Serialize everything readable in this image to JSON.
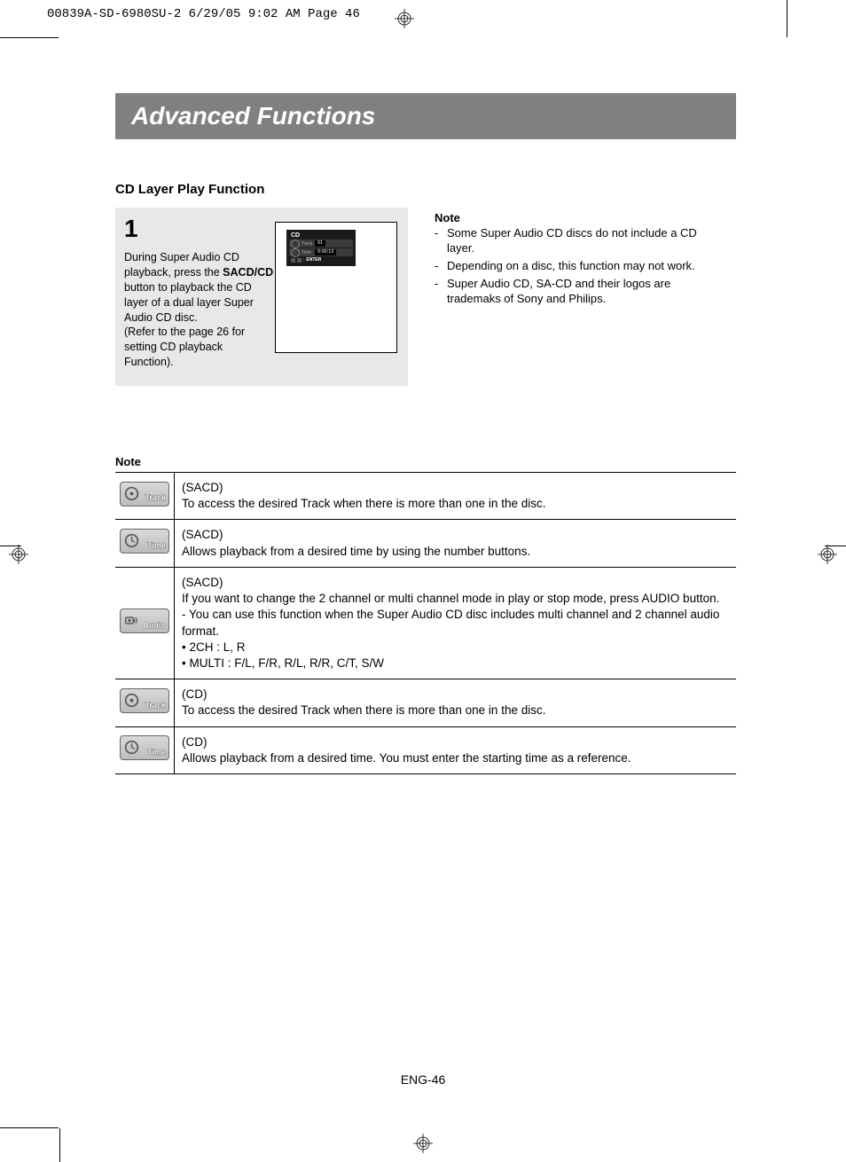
{
  "slug": "00839A-SD-6980SU-2  6/29/05  9:02 AM  Page 46",
  "title": "Advanced Functions",
  "subhead": "CD Layer Play Function",
  "step": {
    "num": "1",
    "text_before_bold": "During Super Audio CD playback, press the ",
    "bold": "SACD/CD",
    "text_after_bold": " button to playback the CD layer of a dual layer Super Audio CD disc.\n(Refer to the page 26 for setting CD playback Function).",
    "osd_title": "CD",
    "osd_track": "01",
    "osd_time": "0:00:13",
    "osd_enter": "ENTER",
    "osd_track_label": "Track",
    "osd_time_label": "Time"
  },
  "side_notes": {
    "heading": "Note",
    "items": [
      "Some Super Audio CD discs do not include a CD layer.",
      "Depending on a disc, this function may not work.",
      "Super Audio CD, SA-CD and their logos are trademaks of Sony and Philips."
    ]
  },
  "table_heading": "Note",
  "rows": [
    {
      "icon": "track",
      "label": "Track",
      "context": "(SACD)",
      "desc": "To access the desired Track when there is more than one in the disc."
    },
    {
      "icon": "time",
      "label": "Time",
      "context": "(SACD)",
      "desc": "Allows playback from a desired time by using the number buttons."
    },
    {
      "icon": "audio",
      "label": "Audio",
      "context": "(SACD)",
      "desc": "If you want to change the 2 channel or multi channel mode in play or stop mode, press AUDIO button.\n- You can use this function when the Super Audio CD disc includes multi channel and 2 channel audio format.\n• 2CH : L, R\n• MULTI : F/L, F/R, R/L, R/R, C/T, S/W"
    },
    {
      "icon": "track",
      "label": "Track",
      "context": "(CD)",
      "desc": "To access the desired Track when there is more than one in the disc."
    },
    {
      "icon": "time",
      "label": "Time",
      "context": "(CD)",
      "desc": "Allows playback from a desired time. You must enter the starting time as a reference."
    }
  ],
  "page_num": "ENG-46"
}
